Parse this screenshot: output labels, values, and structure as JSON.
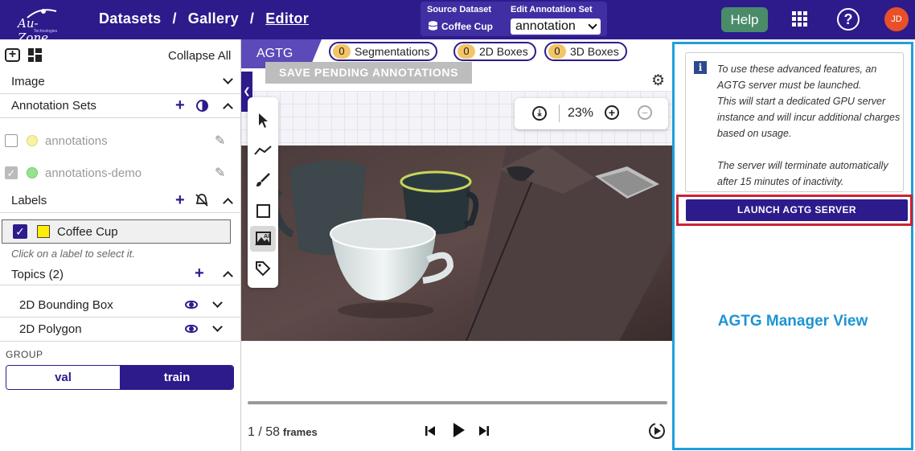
{
  "header": {
    "logo_text": "Au-Zone",
    "logo_sub": "Technologies",
    "breadcrumbs": [
      "Datasets",
      "Gallery",
      "Editor"
    ],
    "separator": "/",
    "source_dataset_label": "Source Dataset",
    "source_dataset_value": "Coffee Cup",
    "edit_annotation_label": "Edit Annotation Set",
    "edit_annotation_value": "annotation",
    "help_label": "Help",
    "user_initials": "JD",
    "colors": {
      "bar": "#2d1b8c",
      "help": "#4a8c6a",
      "avatar": "#e9502a"
    }
  },
  "left_panel": {
    "collapse_all": "Collapse All",
    "image_section": "Image",
    "annotation_sets_title": "Annotation Sets",
    "annotation_sets": [
      {
        "name": "annotations",
        "checked": false,
        "color": "#f5ec8a"
      },
      {
        "name": "annotations-demo",
        "checked": true,
        "color": "#8fe08a"
      }
    ],
    "labels_title": "Labels",
    "labels": [
      {
        "name": "Coffee Cup",
        "checked": true,
        "color": "#ffee00"
      }
    ],
    "labels_hint": "Click on a label to select it.",
    "topics_title": "Topics (2)",
    "topics": [
      "2D Bounding Box",
      "2D Polygon"
    ],
    "group_title": "GROUP",
    "group_options": [
      "val",
      "train"
    ],
    "group_selected": "train"
  },
  "center": {
    "tab_label": "AGTG",
    "pills": [
      {
        "count": "0",
        "label": "Segmentations"
      },
      {
        "count": "0",
        "label": "2D Boxes"
      },
      {
        "count": "0",
        "label": "3D Boxes"
      }
    ],
    "save_button": "SAVE PENDING ANNOTATIONS",
    "zoom_level": "23%",
    "frame_current": "1",
    "frame_total": "58",
    "frames_label": "frames"
  },
  "right_panel": {
    "info_lines": [
      "To use these advanced features, an AGTG server must be launched.",
      "This will start a dedicated GPU server instance and will incur additional charges based on usage.",
      "The server will terminate automatically after 15 minutes of inactivity."
    ],
    "launch_button": "LAUNCH AGTG SERVER",
    "view_title": "AGTG Manager View",
    "colors": {
      "border": "#1fa0db",
      "highlight": "#cc2233"
    }
  }
}
